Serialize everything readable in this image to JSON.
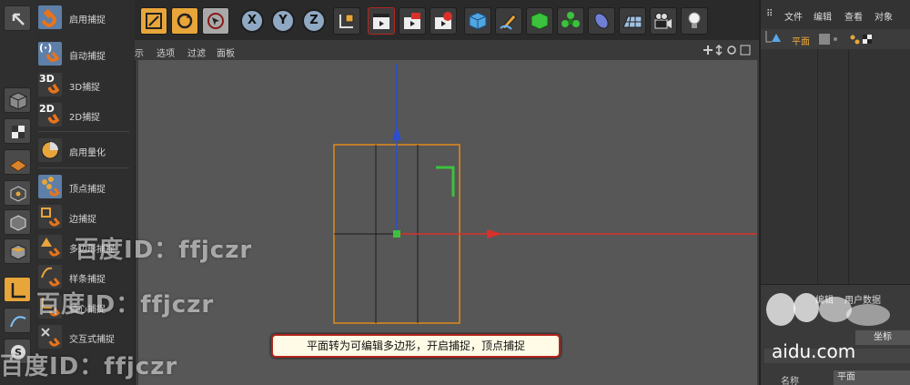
{
  "snap_menu": {
    "items": [
      {
        "label": "启用捕捉",
        "tag": ""
      },
      {
        "label": "自动捕捉",
        "tag": "(·)"
      },
      {
        "label": "3D捕捉",
        "tag": "3D"
      },
      {
        "label": "2D捕捉",
        "tag": "2D"
      },
      {
        "label": "启用量化",
        "tag": ""
      },
      {
        "label": "顶点捕捉",
        "tag": ""
      },
      {
        "label": "边捕捉",
        "tag": ""
      },
      {
        "label": "多边形捕捉",
        "tag": ""
      },
      {
        "label": "样条捕捉",
        "tag": ""
      },
      {
        "label": "轴心捕捉",
        "tag": ""
      },
      {
        "label": "交互式捕捉",
        "tag": ""
      }
    ]
  },
  "toolbar": {
    "axis_x": "X",
    "axis_y": "Y",
    "axis_z": "Z"
  },
  "viewport_menu": {
    "items": [
      "示",
      "选项",
      "过滤",
      "面板"
    ]
  },
  "object_manager": {
    "menu": [
      "文件",
      "编辑",
      "查看",
      "对象"
    ],
    "object_name": "平面"
  },
  "attribute_manager": {
    "menu": [
      "编辑",
      "用户数据"
    ],
    "tab": "坐标",
    "field_label": "名称",
    "field_value": "平面"
  },
  "callout": {
    "text": "平面转为可编辑多边形，开启捕捉，顶点捕捉"
  },
  "watermarks": {
    "text": "百度ID：ffjczr",
    "brand": "aidu.com"
  },
  "colors": {
    "accent": "#e8a53a",
    "x_axis": "#d9302b",
    "y_axis": "#2c4fd1",
    "selection": "#e28a1c",
    "snap_point": "#3cc23c"
  }
}
